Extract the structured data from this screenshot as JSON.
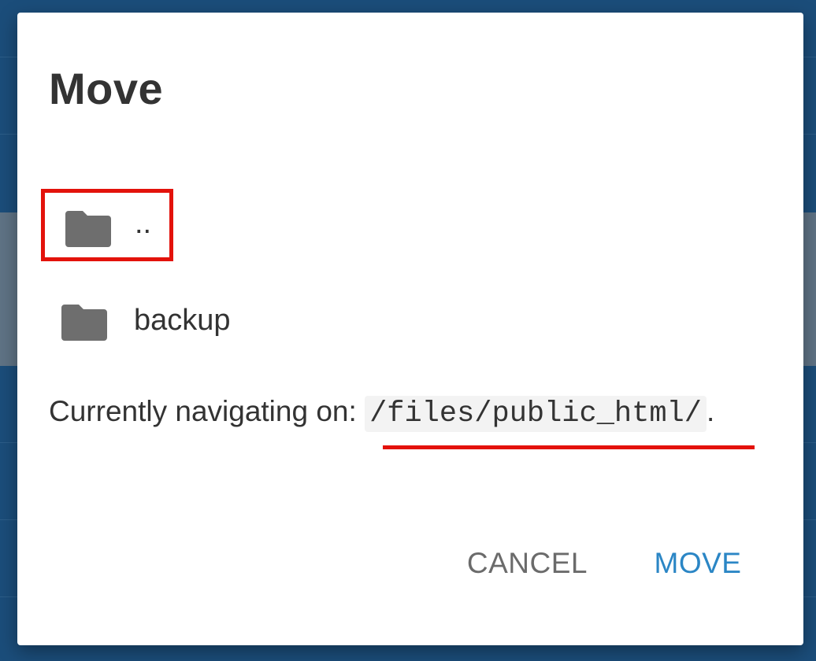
{
  "dialog": {
    "title": "Move",
    "items": [
      {
        "label": "..",
        "icon": "folder-icon",
        "highlighted": true
      },
      {
        "label": "backup",
        "icon": "folder-icon",
        "highlighted": false
      }
    ],
    "status": {
      "prefix": "Currently navigating on: ",
      "path": "/files/public_html/",
      "suffix": "."
    },
    "buttons": {
      "cancel": "CANCEL",
      "move": "MOVE"
    }
  },
  "colors": {
    "highlight": "#e3120b",
    "accent": "#2b86c5",
    "folder": "#6e6e6e",
    "backdrop": "#1b4d7a"
  }
}
